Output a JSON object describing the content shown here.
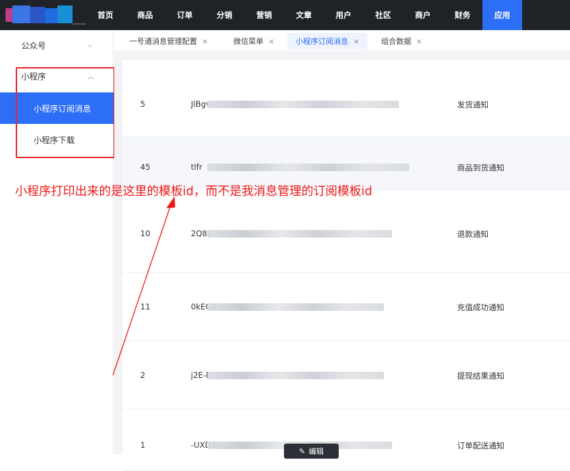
{
  "topnav": {
    "items": [
      "首页",
      "商品",
      "订单",
      "分销",
      "营销",
      "文章",
      "用户",
      "社区",
      "商户",
      "财务",
      "应用"
    ],
    "active_index": 10
  },
  "sidebar": {
    "group1": "公众号",
    "group2": "小程序",
    "sub_items": [
      "小程序订阅消息",
      "小程序下载"
    ]
  },
  "tabs": [
    {
      "label": "一号通消息管理配置",
      "close": "×"
    },
    {
      "label": "微信菜单",
      "close": "×"
    },
    {
      "label": "小程序订阅消息",
      "close": "×"
    },
    {
      "label": "组合数据",
      "close": "×"
    }
  ],
  "table": {
    "rows": [
      {
        "id": "5",
        "tid": "JlBgv",
        "name": "发货通知"
      },
      {
        "id": "45",
        "tid": "tlfr",
        "name": "商品到货通知"
      },
      {
        "id": "10",
        "tid": "2Q8L",
        "name": "退款通知"
      },
      {
        "id": "11",
        "tid": "0kECX",
        "name": "充值成功通知"
      },
      {
        "id": "2",
        "tid": "j2E-l",
        "name": "提现结果通知"
      },
      {
        "id": "1",
        "tid": "-UXD3-",
        "name": "订单配送通知"
      }
    ]
  },
  "annotation": "小程序打印出来的是这里的模板id，而不是我消息管理的订阅模板id",
  "edit_button": "编辑",
  "colors": {
    "accent": "#2d6ef6",
    "annotation": "#e8262d",
    "topbar": "#1f2227"
  }
}
